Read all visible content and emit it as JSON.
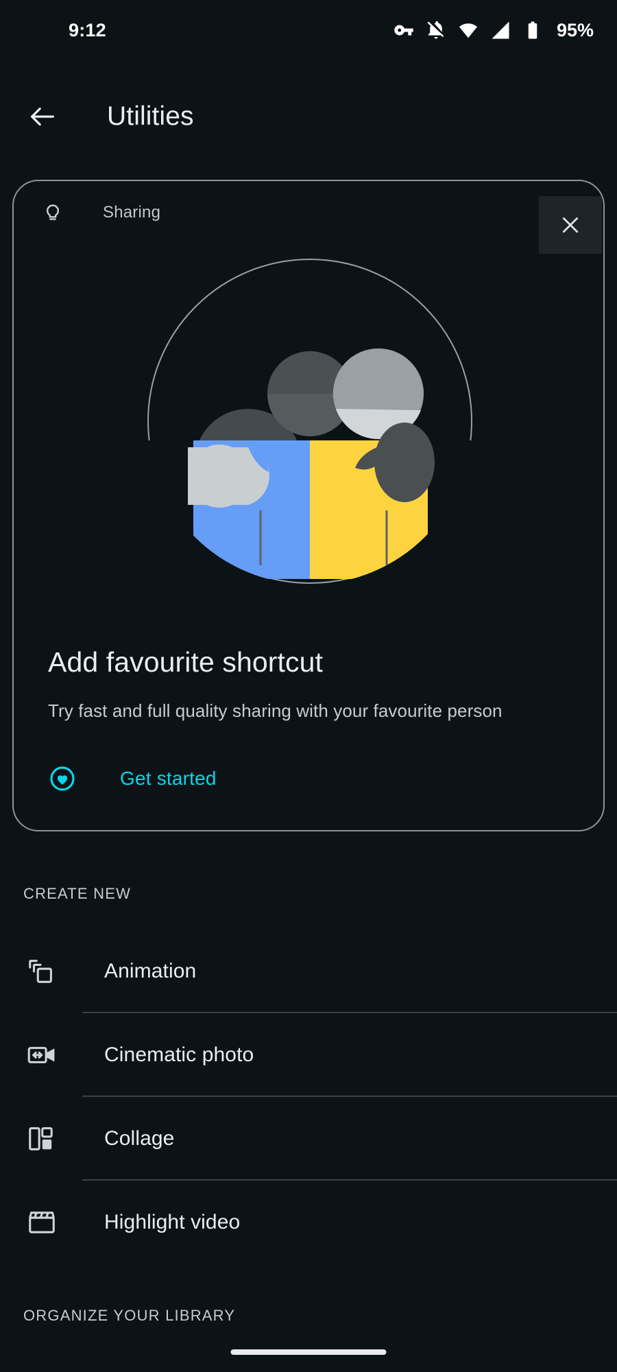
{
  "status_bar": {
    "time": "9:12",
    "battery_percent": "95%",
    "icons": [
      "vpn-key-icon",
      "notifications-muted-icon",
      "wifi-icon",
      "cellular-signal-icon",
      "battery-icon"
    ]
  },
  "app_bar": {
    "back_icon": "back-arrow-icon",
    "title": "Utilities"
  },
  "promo_card": {
    "chip_icon": "lightbulb-icon",
    "chip_label": "Sharing",
    "close_icon": "close-icon",
    "illustration": "two-people-hugging-illustration",
    "title": "Add favourite shortcut",
    "subtitle": "Try fast and full quality sharing with your favourite person",
    "action_icon": "heart-in-circle-icon",
    "action_label": "Get started",
    "accent_color": "#0ad6e8",
    "border_color": "#8e9496"
  },
  "sections": {
    "create_new": "CREATE NEW",
    "organize_library": "ORGANIZE YOUR LIBRARY"
  },
  "create_new_items": [
    {
      "label": "Animation",
      "icon": "layers-stack-icon"
    },
    {
      "label": "Cinematic photo",
      "icon": "video-camera-arrows-icon"
    },
    {
      "label": "Collage",
      "icon": "collage-grid-icon"
    },
    {
      "label": "Highlight video",
      "icon": "clapperboard-icon"
    }
  ],
  "colors": {
    "background": "#0c1317",
    "text_primary": "#e9eef2",
    "text_secondary": "#c6ccd0",
    "accent": "#0ad6e8",
    "illustration_blue": "#669df6",
    "illustration_yellow": "#fdd33f"
  }
}
